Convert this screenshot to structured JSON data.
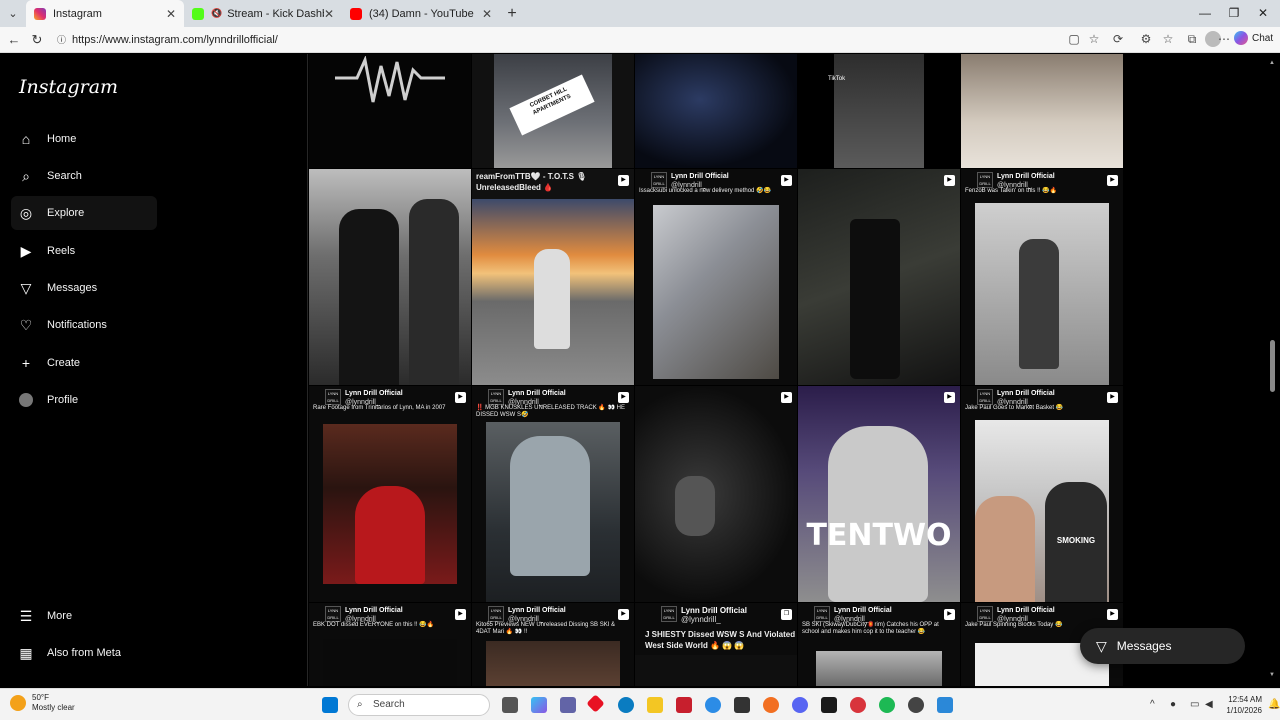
{
  "browser": {
    "tabs": [
      {
        "title": "Instagram",
        "active": true,
        "favicon_color": "#e1306c"
      },
      {
        "title": "Stream - Kick Dashboard",
        "active": false,
        "favicon_color": "#53fc18",
        "muted": true
      },
      {
        "title": "(34) Damn - YouTube",
        "active": false,
        "favicon_color": "#ff0000"
      }
    ],
    "url": "https://www.instagram.com/lynndrillofficial/",
    "chat_label": "Chat"
  },
  "sidebar": {
    "logo": "Instagram",
    "items": [
      {
        "label": "Home",
        "icon": "home-icon"
      },
      {
        "label": "Search",
        "icon": "search-icon"
      },
      {
        "label": "Explore",
        "icon": "compass-icon"
      },
      {
        "label": "Reels",
        "icon": "reels-icon"
      },
      {
        "label": "Messages",
        "icon": "messenger-icon"
      },
      {
        "label": "Notifications",
        "icon": "heart-icon"
      },
      {
        "label": "Create",
        "icon": "plus-icon"
      },
      {
        "label": "Profile",
        "icon": "avatar"
      }
    ],
    "bottom": [
      {
        "label": "More",
        "icon": "menu-icon"
      },
      {
        "label": "Also from Meta",
        "icon": "meta-icon"
      }
    ]
  },
  "posts": {
    "account_name": "Lynn Drill Official",
    "account_handle": "@lynndrill_",
    "row2": [
      {
        "caption": "",
        "text": ""
      },
      {
        "caption": "",
        "text": "reamFromTTB🤍 - T.O.T.S 🎙 UnreleasedBleed 🩸"
      },
      {
        "caption": "Issacksubi unlocked a new delivery method 🤣😂",
        "text": ""
      },
      {
        "caption": "",
        "text": ""
      },
      {
        "caption": "FenzoB was Talkin' on this !! 😂🔥",
        "text": ""
      }
    ],
    "row3": [
      {
        "caption": "Rare Footage from Trinitarios of Lynn, MA in 2007",
        "text": ""
      },
      {
        "caption": "‼️ MGB KNUSKLES UNRELEASED TRACK 🔥 👀 HE DISSED WSW S🤣",
        "text": ""
      },
      {
        "caption": "",
        "text": ""
      },
      {
        "caption": "",
        "text": "TENTWO"
      },
      {
        "caption": "Jake Paul Goes to Market Basket 😂",
        "text": "SMOKING"
      }
    ],
    "row4": [
      {
        "caption": "EBK DOT dissed EVERYONE on this !! 😂🔥",
        "text": ""
      },
      {
        "caption": "Kito65 Previews NEW Unreleased Dissing SB SKI & 4DAT Mari 🔥 👀 !!",
        "text": ""
      },
      {
        "caption": "",
        "text": "J SHIESTY Dissed WSW S And Violated West Side World 🔥 😱 😱"
      },
      {
        "caption": "SB SKI (Skiway/DubCity🏮rim) Catches his OPP at school and makes him cop it to the teacher 😂",
        "text": ""
      },
      {
        "caption": "Jake Paul Spinning Blocks Today 😂",
        "text": ""
      }
    ],
    "row1_texts": [
      "",
      "CORBET HILL APARTMENTS",
      "",
      "TikTok",
      ""
    ]
  },
  "floating": {
    "messages_label": "Messages"
  },
  "taskbar": {
    "weather_temp": "50°F",
    "weather_desc": "Mostly clear",
    "search_placeholder": "Search",
    "time": "12:54 AM",
    "date": "1/10/2026"
  }
}
